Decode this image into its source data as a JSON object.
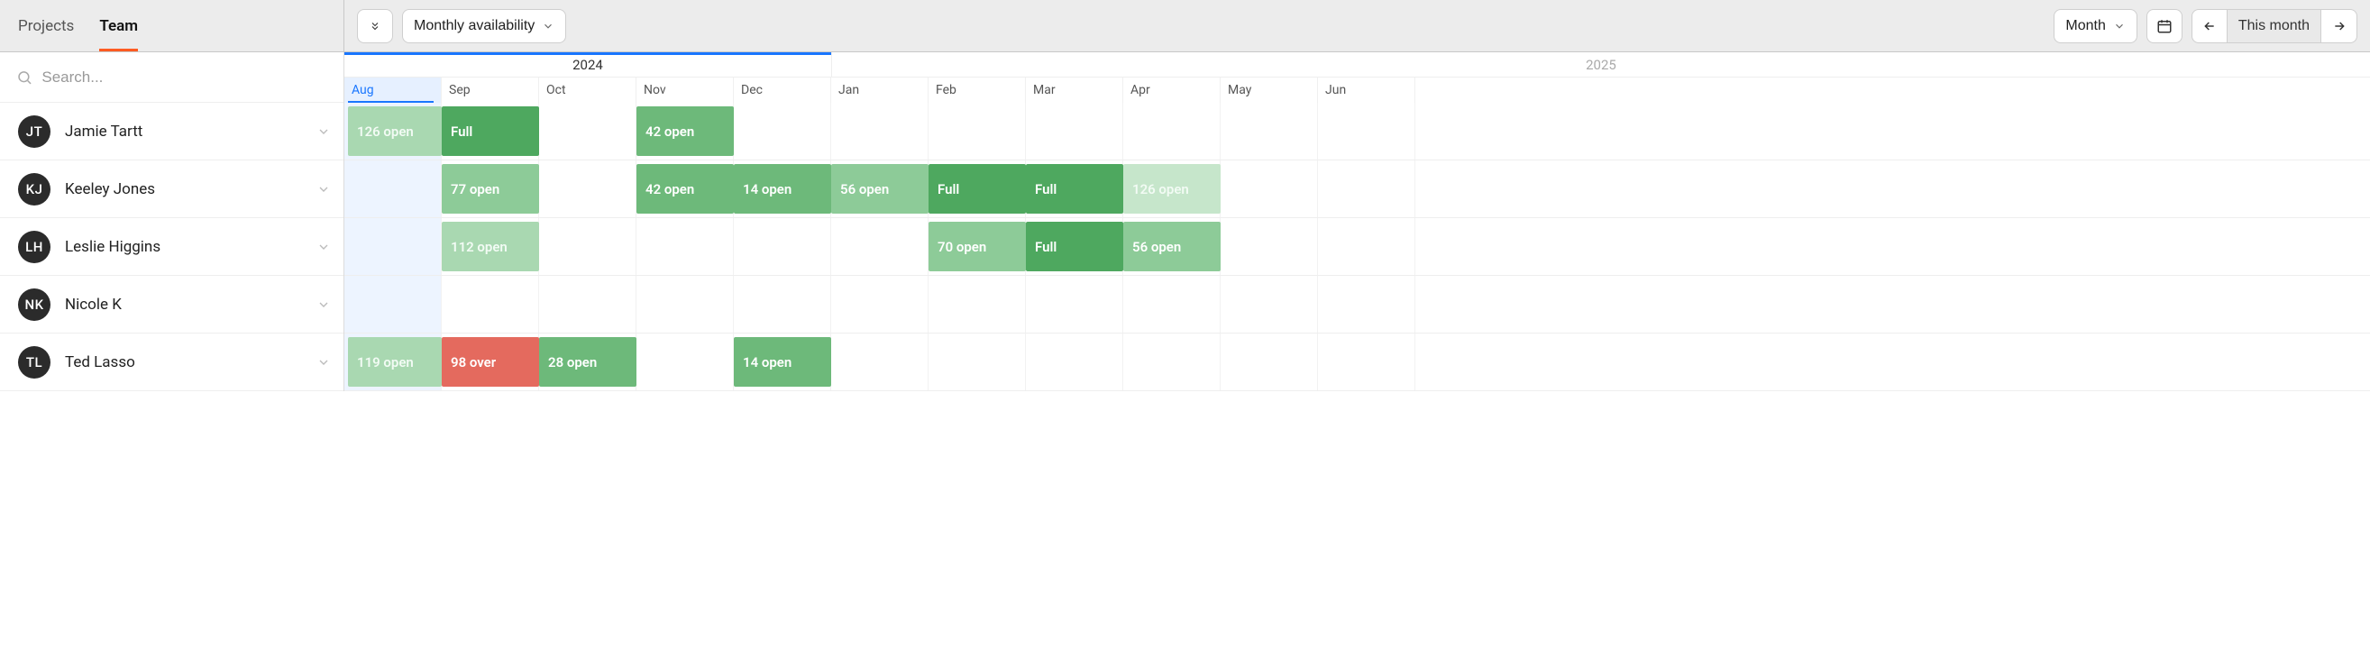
{
  "tabs": {
    "projects": "Projects",
    "team": "Team"
  },
  "toolbar": {
    "dropdown_label": "Monthly availability",
    "view_label": "Month",
    "this_month_label": "This month"
  },
  "search": {
    "placeholder": "Search..."
  },
  "years": {
    "y2024": "2024",
    "y2025": "2025"
  },
  "months": [
    "Aug",
    "Sep",
    "Oct",
    "Nov",
    "Dec",
    "Jan",
    "Feb",
    "Mar",
    "Apr",
    "May",
    "Jun"
  ],
  "people": [
    {
      "initials": "JT",
      "name": "Jamie Tartt"
    },
    {
      "initials": "KJ",
      "name": "Keeley Jones"
    },
    {
      "initials": "LH",
      "name": "Leslie Higgins"
    },
    {
      "initials": "NK",
      "name": "Nicole K"
    },
    {
      "initials": "TL",
      "name": "Ted Lasso"
    }
  ],
  "cells": {
    "r0": {
      "aug": "126 open",
      "sep": "Full",
      "nov": "42 open"
    },
    "r1": {
      "sep": "77 open",
      "nov": "42 open",
      "dec": "14 open",
      "jan": "56 open",
      "feb": "Full",
      "mar": "Full",
      "apr": "126 open"
    },
    "r2": {
      "sep": "112 open",
      "feb": "70 open",
      "mar": "Full",
      "apr": "56 open"
    },
    "r4": {
      "aug": "119 open",
      "sep": "98 over",
      "oct": "28 open",
      "dec": "14 open"
    }
  }
}
